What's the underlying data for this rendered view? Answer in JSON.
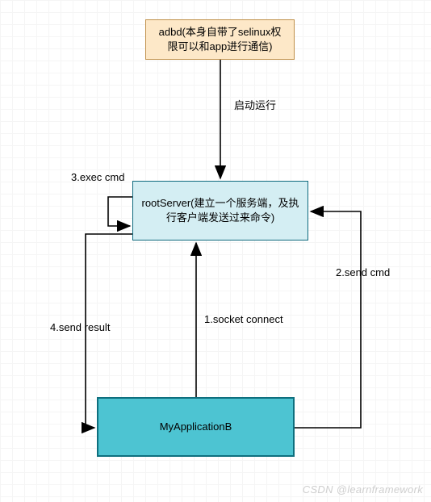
{
  "nodes": {
    "adbd": "adbd(本身自带了selinux权限可以和app进行通信)",
    "rootServer": "rootServer(建立一个服务端，及执行客户端发送过来命令)",
    "myApp": "MyApplicationB"
  },
  "edges": {
    "start": "启动运行",
    "step1": "1.socket connect",
    "step2": "2.send cmd",
    "step3": "3.exec cmd",
    "step4": "4.send result"
  },
  "watermark": "CSDN @learnframework"
}
